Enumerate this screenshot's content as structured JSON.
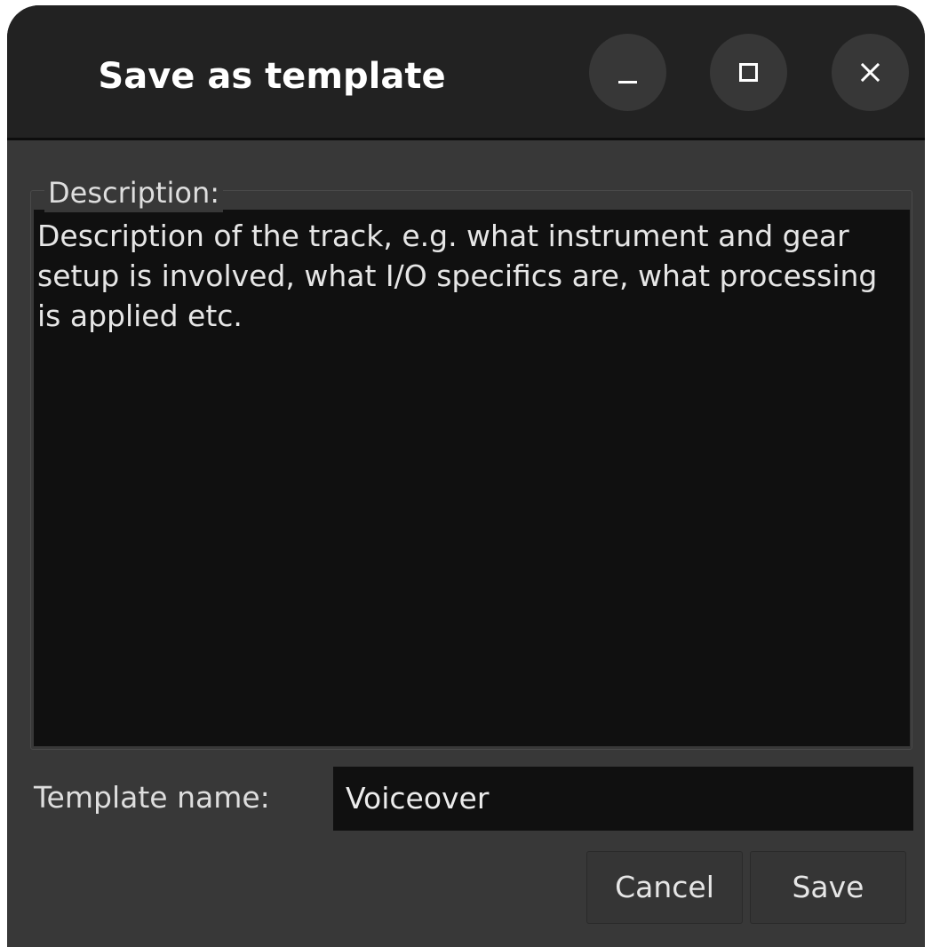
{
  "window": {
    "title": "Save as template",
    "controls": [
      "minimize-icon",
      "maximize-icon",
      "close-icon"
    ]
  },
  "description": {
    "label": "Description:",
    "text": "Description of the track, e.g. what instrument and gear setup is involved, what I/O specifics are, what processing is applied etc."
  },
  "template_name": {
    "label": "Template name:",
    "value": "Voiceover"
  },
  "buttons": {
    "cancel": "Cancel",
    "save": "Save"
  },
  "colors": {
    "window_bg": "#383838",
    "titlebar_bg": "#222222",
    "field_bg": "#101010",
    "text": "#e6e6e6"
  }
}
